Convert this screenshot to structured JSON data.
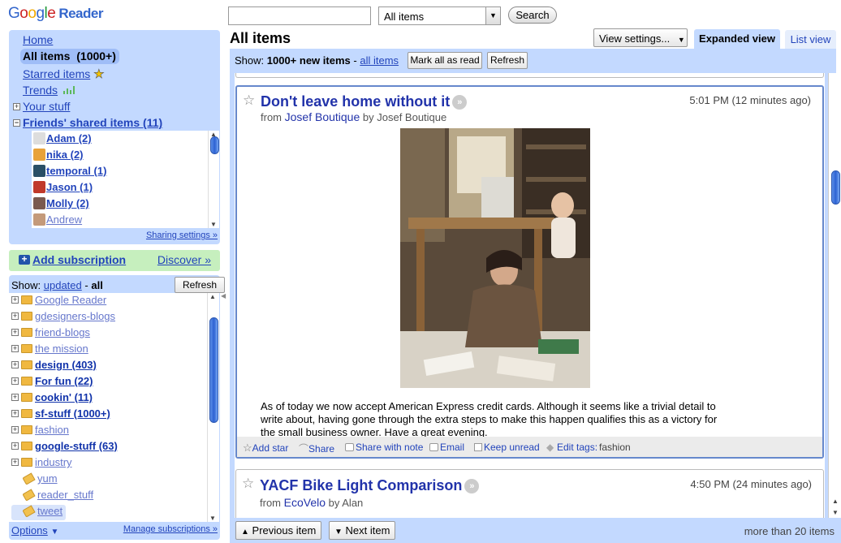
{
  "logo": {
    "google": "Google",
    "product": "Reader"
  },
  "search": {
    "value": "",
    "scope_selected": "All items",
    "button_label": "Search"
  },
  "nav": {
    "home": "Home",
    "all_items": "All items",
    "all_items_count": "(1000+)",
    "starred": "Starred items",
    "trends": "Trends",
    "your_stuff": "Your stuff",
    "friends_shared": "Friends' shared items (11)",
    "friends": [
      {
        "name": "Adam (2)",
        "unread": true,
        "avatar_color": "#dddddd"
      },
      {
        "name": "nika (2)",
        "unread": true,
        "avatar_color": "#e8a23a"
      },
      {
        "name": "temporal (1)",
        "unread": true,
        "avatar_color": "#2a4f66"
      },
      {
        "name": "Jason (1)",
        "unread": true,
        "avatar_color": "#c0392b"
      },
      {
        "name": "Molly (2)",
        "unread": true,
        "avatar_color": "#7a5a50"
      },
      {
        "name": "Andrew",
        "unread": false,
        "avatar_color": "#c49a7a"
      }
    ],
    "sharing_settings": "Sharing settings »"
  },
  "add_subscription": {
    "label": "Add subscription",
    "discover": "Discover »"
  },
  "subscriptions": {
    "show_prefix": "Show:",
    "show_updated": "updated",
    "show_sep": "-",
    "show_all": "all",
    "refresh_label": "Refresh",
    "items": [
      {
        "type": "folder",
        "name": "Google Reader",
        "bold": false
      },
      {
        "type": "folder",
        "name": "gdesigners-blogs",
        "bold": false
      },
      {
        "type": "folder",
        "name": "friend-blogs",
        "bold": false
      },
      {
        "type": "folder",
        "name": "the mission",
        "bold": false
      },
      {
        "type": "folder",
        "name": "design (403)",
        "bold": true
      },
      {
        "type": "folder",
        "name": "For fun (22)",
        "bold": true
      },
      {
        "type": "folder",
        "name": "cookin' (11)",
        "bold": true
      },
      {
        "type": "folder",
        "name": "sf-stuff (1000+)",
        "bold": true
      },
      {
        "type": "folder",
        "name": "fashion",
        "bold": false
      },
      {
        "type": "folder",
        "name": "google-stuff (63)",
        "bold": true
      },
      {
        "type": "folder",
        "name": "industry",
        "bold": false
      },
      {
        "type": "tag",
        "name": "yum",
        "bold": false
      },
      {
        "type": "tag",
        "name": "reader_stuff",
        "bold": false
      },
      {
        "type": "tag",
        "name": "tweet",
        "bold": false
      }
    ],
    "options": "Options",
    "manage": "Manage subscriptions »"
  },
  "main": {
    "title": "All items",
    "view_settings": "View settings...",
    "tab_expanded": "Expanded view",
    "tab_list": "List view",
    "show_label": "Show:",
    "new_items": "1000+ new items",
    "show_dash": "-",
    "all_items_link": "all items",
    "mark_all_read": "Mark all as read",
    "refresh": "Refresh"
  },
  "entries": [
    {
      "title": "Don't leave home without it",
      "time": "5:01 PM (12 minutes ago)",
      "from_label": "from",
      "source": "Josef Boutique",
      "by_label": "by",
      "author": "Josef Boutique",
      "body": "As of today we now accept American Express credit cards. Although it seems like a trivial detail to write about, having gone through the extra steps to make this happen qualifies this as a victory for the small business owner. Have a great evening.",
      "actions": {
        "add_star": "Add star",
        "share": "Share",
        "share_with_note": "Share with note",
        "email": "Email",
        "keep_unread": "Keep unread",
        "edit_tags": "Edit tags:",
        "tags": "fashion"
      }
    },
    {
      "title": "YACF Bike Light Comparison",
      "time": "4:50 PM (24 minutes ago)",
      "from_label": "from",
      "source": "EcoVelo",
      "by_label": "by",
      "author": "Alan"
    }
  ],
  "bottom": {
    "previous": "Previous item",
    "next": "Next item",
    "count": "more than 20 items"
  },
  "colors": {
    "nav_blue": "#c3d9ff",
    "add_green": "#c6efbe",
    "link": "#2244bb",
    "title_blue": "#2233aa"
  }
}
